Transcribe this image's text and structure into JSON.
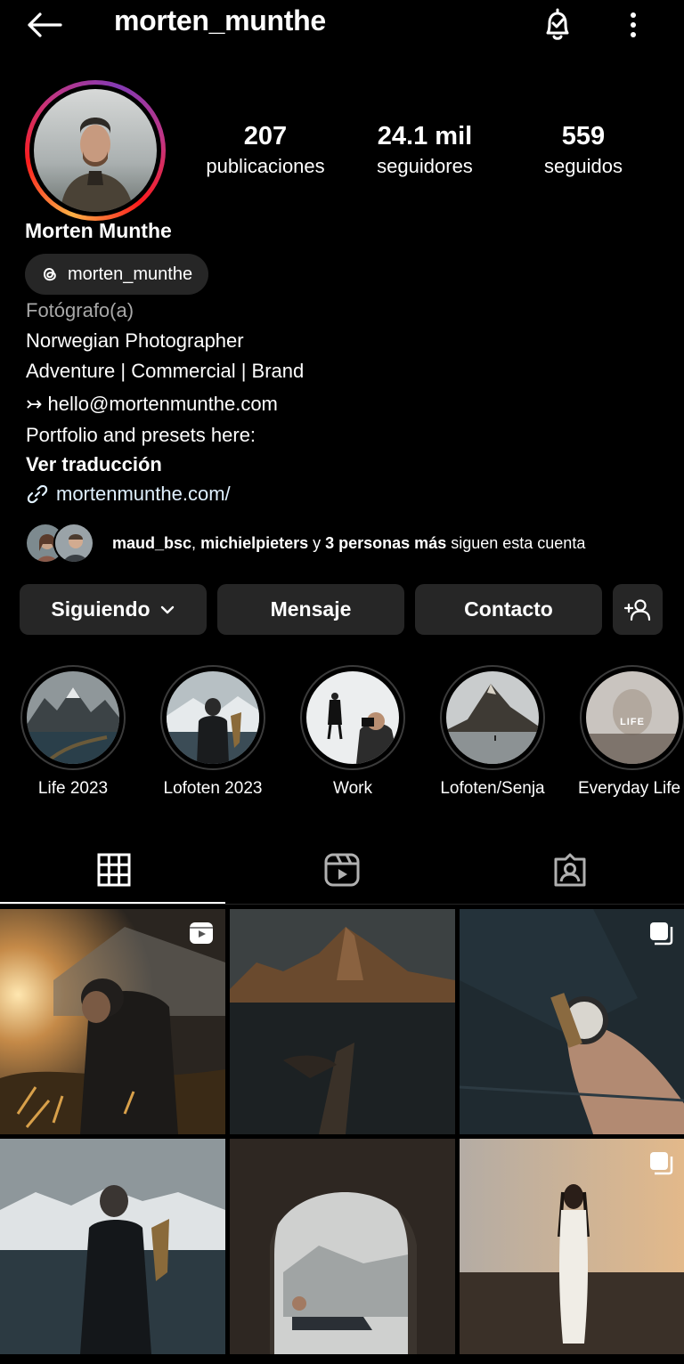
{
  "header": {
    "username": "morten_munthe",
    "icons": [
      "back-arrow-icon",
      "notification-bell-icon",
      "more-vertical-icon"
    ]
  },
  "stats": [
    {
      "value": "207",
      "label": "publicaciones"
    },
    {
      "value": "24.1 mil",
      "label": "seguidores"
    },
    {
      "value": "559",
      "label": "seguidos"
    }
  ],
  "profile": {
    "full_name": "Morten Munthe",
    "threads_handle": "morten_munthe",
    "category": "Fotógrafo(a)",
    "bio": {
      "line1": "Norwegian Photographer",
      "line2": "Adventure | Commercial | Brand",
      "line3": "↣ hello@mortenmunthe.com",
      "line4": "Portfolio and presets here:"
    },
    "see_translation": "Ver traducción",
    "website": "mortenmunthe.com/"
  },
  "followed_by": {
    "user1": "maud_bsc",
    "sep": ", ",
    "user2": "michielpieters",
    "mid": " y ",
    "others": "3 personas más",
    "tail": " siguen esta cuenta"
  },
  "actions": {
    "following": "Siguiendo",
    "message": "Mensaje",
    "contact": "Contacto"
  },
  "highlights": [
    {
      "title": "Life 2023"
    },
    {
      "title": "Lofoten 2023"
    },
    {
      "title": "Work"
    },
    {
      "title": "Lofoten/Senja"
    },
    {
      "title": "Everyday Life"
    }
  ],
  "highlight_overlay_text": "LIFE",
  "tabs": [
    "grid-icon",
    "reels-icon",
    "tagged-icon"
  ],
  "posts": [
    {
      "type": "reel"
    },
    {
      "type": "photo"
    },
    {
      "type": "carousel"
    },
    {
      "type": "photo"
    },
    {
      "type": "photo"
    },
    {
      "type": "carousel"
    }
  ],
  "colors": {
    "background": "#000000",
    "button": "#262626",
    "muted_text": "#a8a8a8",
    "link": "#e0f1ff"
  }
}
